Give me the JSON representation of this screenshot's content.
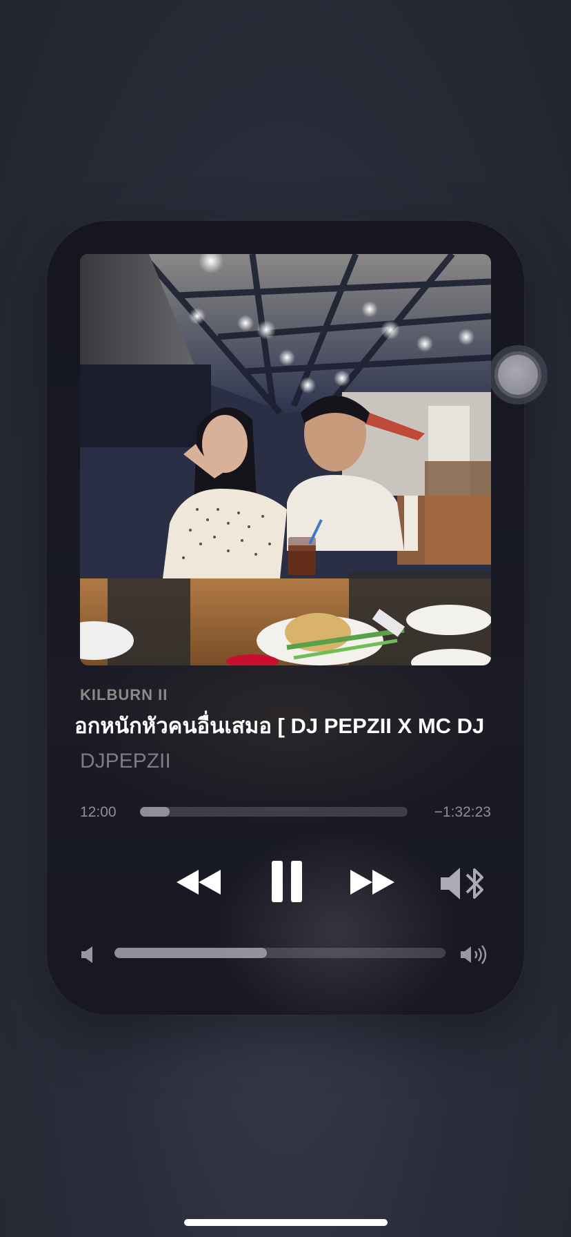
{
  "now_playing": {
    "album": "KILBURN II",
    "title": "อกหนักหัวคนอื่นเสมอ  [ DJ PEPZII X MC DJ",
    "artist": "DJPEPZII",
    "elapsed": "12:00",
    "remaining": "−1:32:23",
    "progress_fraction": 0.11,
    "volume_fraction": 0.46
  },
  "controls": {
    "rewind_icon": "rewind-icon",
    "pause_icon": "pause-icon",
    "forward_icon": "fast-forward-icon",
    "airplay_icon": "speaker-bluetooth-icon"
  },
  "colors": {
    "background": "#2b2d3b",
    "card": "#15161f",
    "progress_fill": "#a5a5ad",
    "text_primary": "#ffffff"
  }
}
